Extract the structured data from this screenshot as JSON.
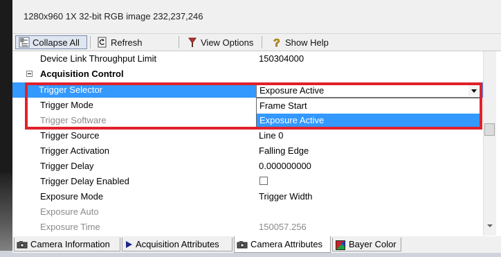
{
  "info_bar": {
    "text": "1280x960   1X   32-bit RGB image   232,237,246"
  },
  "toolbar": {
    "collapse_all": "Collapse All",
    "refresh": "Refresh",
    "view_options": "View Options",
    "show_help": "Show Help"
  },
  "grid": {
    "rows": [
      {
        "name": "Device Link Throughput Limit",
        "value": "150304000"
      },
      {
        "name": "Acquisition Control",
        "value": ""
      },
      {
        "name": "Trigger Selector",
        "value": "Exposure Active"
      },
      {
        "name": "Trigger Mode",
        "value": ""
      },
      {
        "name": "Trigger Software",
        "value": ""
      },
      {
        "name": "Trigger Source",
        "value": "Line 0"
      },
      {
        "name": "Trigger Activation",
        "value": "Falling Edge"
      },
      {
        "name": "Trigger Delay",
        "value": "0.000000000"
      },
      {
        "name": "Trigger Delay Enabled",
        "value": ""
      },
      {
        "name": "Exposure Mode",
        "value": "Trigger Width"
      },
      {
        "name": "Exposure Auto",
        "value": ""
      },
      {
        "name": "Exposure Time",
        "value": "150057.256"
      }
    ]
  },
  "dropdown": {
    "selected": "Exposure Active",
    "options": [
      "Frame Start",
      "Exposure Active"
    ]
  },
  "tabs": [
    {
      "label": "Camera Information"
    },
    {
      "label": "Acquisition Attributes"
    },
    {
      "label": "Camera Attributes"
    },
    {
      "label": "Bayer Color"
    }
  ],
  "colors": {
    "selection": "#3399ff",
    "highlight_box": "#e0212c"
  }
}
